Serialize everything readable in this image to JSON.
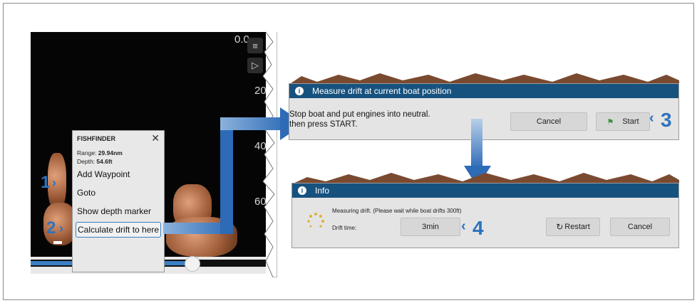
{
  "sonar": {
    "depths": [
      "0.0",
      "20.0",
      "40.0",
      "60.0"
    ]
  },
  "menu": {
    "title": "FISHFINDER",
    "range_label": "Range:",
    "range_value": "29.94nm",
    "depth_label": "Depth:",
    "depth_value": "54.6ft",
    "items": [
      "Add Waypoint",
      "Goto",
      "Show depth marker",
      "Calculate drift to here"
    ]
  },
  "dialog1": {
    "title": "Measure drift at current boat position",
    "message_line1": "Stop boat and put engines into neutral.",
    "message_line2": "then press START.",
    "cancel_label": "Cancel",
    "start_label": "Start"
  },
  "dialog2": {
    "title": "Info",
    "status": "Measuring drift. (Please wait while boat drifts 300ft)",
    "drift_label": "Drift time:",
    "drift_value": "3min",
    "restart_label": "Restart",
    "cancel_label": "Cancel"
  },
  "steps": [
    "1",
    "2",
    "3",
    "4"
  ],
  "colors": {
    "accent": "#2f72bd",
    "titlebar": "#17527f",
    "start_flag": "#3e8e3e"
  }
}
